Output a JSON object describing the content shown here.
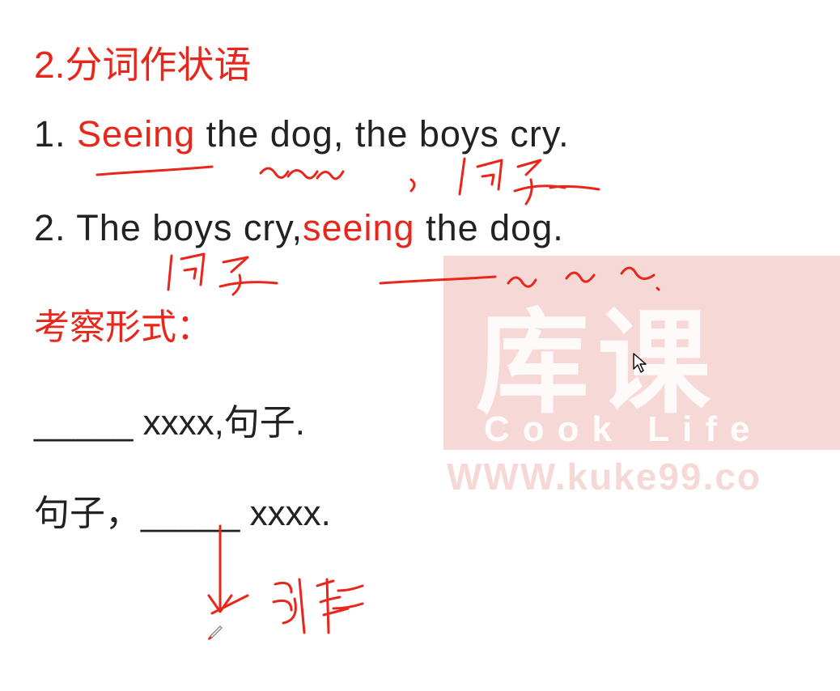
{
  "slide": {
    "title": "2.分词作状语",
    "sentence1": {
      "number": "1. ",
      "highlight": "Seeing",
      "rest": " the dog, the boys cry."
    },
    "sentence2": {
      "lead": "2. The boys cry,",
      "highlight": "seeing",
      "rest": " the dog."
    },
    "form_label": "考察形式：",
    "pattern1": "_____ xxxx,句子.",
    "pattern2": "句子，_____ xxxx."
  },
  "watermark": {
    "logo_text": "库课",
    "tagline": "Cook Life",
    "url": "WWW.kuke99.co"
  },
  "colors": {
    "accent": "#e8261b",
    "text": "#222222"
  },
  "icons": {
    "cursor": "arrow-cursor-icon",
    "pen": "pen-cursor-icon"
  }
}
